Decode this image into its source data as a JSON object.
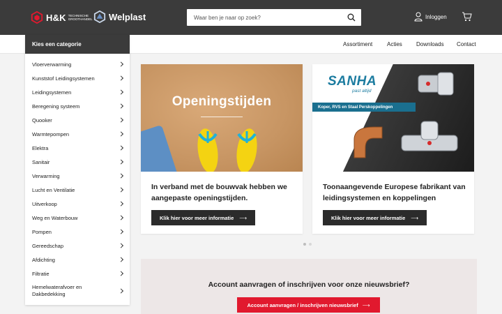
{
  "header": {
    "logo_hk_name": "H&K",
    "logo_hk_sub": "Technische Groothandel",
    "logo_wp_name": "Welplast",
    "search_placeholder": "Waar ben je naar op zoek?",
    "login_label": "Inloggen",
    "icons": [
      "hk-logo-icon",
      "welplast-logo-icon",
      "search-icon",
      "user-icon",
      "cart-icon"
    ],
    "colors": {
      "bar": "#3b3b3b",
      "accent": "#e1192e"
    }
  },
  "nav": {
    "links": [
      "Assortiment",
      "Acties",
      "Downloads",
      "Contact"
    ]
  },
  "categories": {
    "heading": "Kies een categorie",
    "items": [
      "Vloerverwarming",
      "Kunststof Leidingsystemen",
      "Leidingsystemen",
      "Beregening systeem",
      "Quooker",
      "Warmtepompen",
      "Elektra",
      "Sanitair",
      "Verwarming",
      "Lucht en Ventilatie",
      "Uitverkoop",
      "Weg en Waterbouw",
      "Pompen",
      "Gereedschap",
      "Afdichting",
      "Filtratie",
      "Hemelwaterafvoer en Dakbedekking"
    ]
  },
  "cards": [
    {
      "image_text": "Openingstijden",
      "title": "In verband met de bouwvak hebben we aangepaste openingstijden.",
      "button": "Klik hier voor meer informatie"
    },
    {
      "image_brand": "SANHA",
      "image_tagline": "past altijd",
      "image_banner": "Koper, RVS en Staal Perskoppelingen",
      "title": "Toonaangevende Europese fabrikant van leidingsystemen en koppelingen",
      "button": "Klik hier voor meer informatie"
    }
  ],
  "carousel": {
    "slides": 2,
    "active": 1
  },
  "newsletter": {
    "title": "Account aanvragen of inschrijven voor onze nieuwsbrief?",
    "button": "Account aanvragen / inschrijven nieuwsbrief"
  }
}
